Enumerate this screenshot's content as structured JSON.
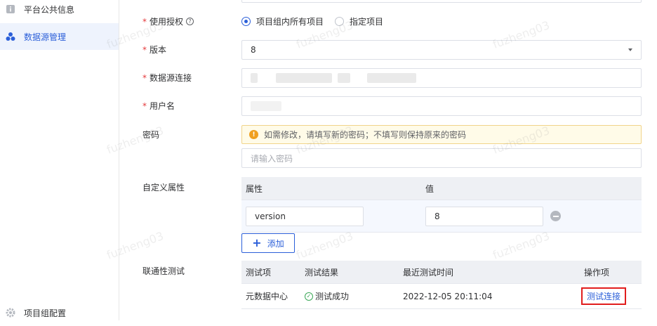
{
  "sidebar": {
    "items": [
      {
        "label": "平台公共信息",
        "icon": "info-icon"
      },
      {
        "label": "数据源管理",
        "icon": "cluster-icon",
        "active": true
      },
      {
        "label": "项目组配置",
        "icon": "gear-icon"
      }
    ]
  },
  "form": {
    "auth": {
      "label": "使用授权",
      "options": [
        "项目组内所有项目",
        "指定项目"
      ],
      "selected": 0
    },
    "version": {
      "label": "版本",
      "value": "8"
    },
    "connection": {
      "label": "数据源连接"
    },
    "username": {
      "label": "用户名"
    },
    "password": {
      "label": "密码",
      "warning": "如需修改，请填写新的密码；不填写则保持原来的密码",
      "placeholder": "请输入密码"
    },
    "custom_props": {
      "label": "自定义属性",
      "headers": [
        "属性",
        "值"
      ],
      "rows": [
        {
          "key": "version",
          "value": "8"
        }
      ],
      "add_label": "添加"
    },
    "connectivity": {
      "label": "联通性测试",
      "headers": [
        "测试项",
        "测试结果",
        "最近测试时间",
        "操作项"
      ],
      "rows": [
        {
          "item": "元数据中心",
          "result": "测试成功",
          "time": "2022-12-05 20:11:04",
          "action": "测试连接"
        }
      ]
    }
  },
  "watermark": "fuzheng03",
  "colors": {
    "accent": "#2b5fd9",
    "required": "#e4393c",
    "success": "#3aa757",
    "warning": "#f0a020",
    "highlight": "#e11d1d"
  }
}
